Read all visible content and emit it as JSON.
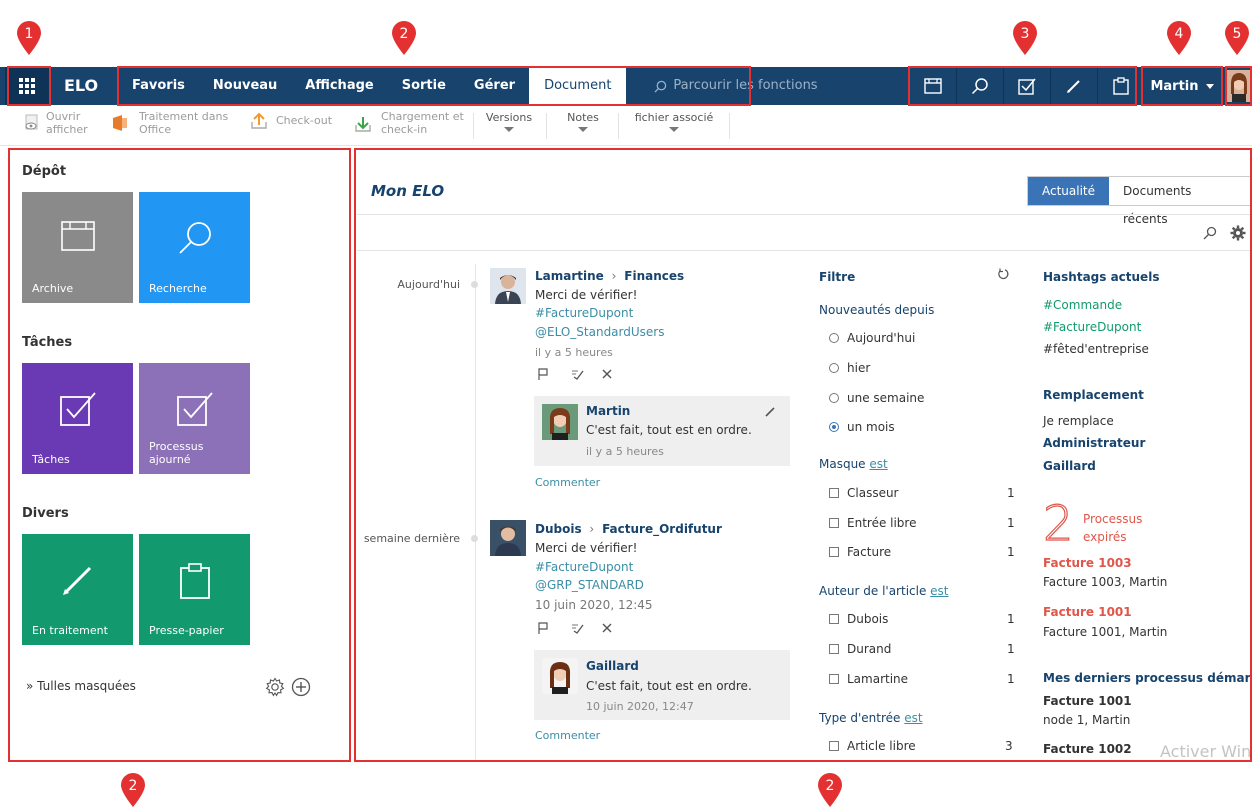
{
  "topbar": {
    "brand": "ELO",
    "menu": [
      "Favoris",
      "Nouveau",
      "Affichage",
      "Sortie",
      "Gérer",
      "Document"
    ],
    "search_placeholder": "Parcourir les fonctions",
    "user": "Martin"
  },
  "callouts": [
    "1",
    "2",
    "3",
    "4",
    "5",
    "2",
    "2"
  ],
  "ribbon": {
    "open": [
      "Ouvrir",
      "afficher"
    ],
    "office": [
      "Traitement dans",
      "Office"
    ],
    "checkout": "Check-out",
    "checkin": [
      "Chargement et",
      "check-in"
    ],
    "versions": "Versions",
    "notes": "Notes",
    "associated": "fichier associé"
  },
  "left": {
    "depot": "Dépôt",
    "taches_title": "Tâches",
    "divers": "Divers",
    "tiles": {
      "archive": "Archive",
      "recherche": "Recherche",
      "taches": "Tâches",
      "processus": [
        "Processus",
        "ajourné"
      ],
      "traitement": "En traitement",
      "presse": "Presse-papier"
    },
    "hidden_tiles": "» Tulles masquées"
  },
  "main": {
    "title": "Mon ELO",
    "tabs": [
      "Actualité",
      "Documents récents"
    ],
    "feed": [
      {
        "date": "Aujourd'hui",
        "author": "Lamartine",
        "target": "Finances",
        "text": "Merci de vérifier!",
        "hashtag": "#FactureDupont",
        "mention": "@ELO_StandardUsers",
        "time": "il y a 5 heures",
        "reply": {
          "author": "Martin",
          "text": "C'est fait, tout est en ordre.",
          "time": "il y a 5 heures"
        },
        "comment": "Commenter"
      },
      {
        "date": "semaine dernière",
        "author": "Dubois",
        "target": "Facture_Ordifutur",
        "text": "Merci de vérifier!",
        "hashtag": "#FactureDupont",
        "mention": "@GRP_STANDARD",
        "time": "10 juin 2020, 12:45",
        "reply": {
          "author": "Gaillard",
          "text": "C'est fait, tout est en ordre.",
          "time": "10 juin 2020, 12:47"
        },
        "comment": "Commenter"
      }
    ],
    "filter": {
      "title": "Filtre",
      "since_label": "Nouveautés depuis",
      "since_options": [
        "Aujourd'hui",
        "hier",
        "une semaine",
        "un mois"
      ],
      "selected_since": "un mois",
      "mask_label": "Masque",
      "is": "est",
      "mask_items": [
        {
          "label": "Classeur",
          "count": "1"
        },
        {
          "label": "Entrée libre",
          "count": "1"
        },
        {
          "label": "Facture",
          "count": "1"
        }
      ],
      "author_label": "Auteur de l'article",
      "author_items": [
        {
          "label": "Dubois",
          "count": "1"
        },
        {
          "label": "Durand",
          "count": "1"
        },
        {
          "label": "Lamartine",
          "count": "1"
        }
      ],
      "type_label": "Type d'entrée",
      "type_items": [
        {
          "label": "Article libre",
          "count": "3"
        }
      ]
    },
    "right": {
      "hashtags_title": "Hashtags actuels",
      "hashtags": [
        "#Commande",
        "#FactureDupont",
        "#fêted'entreprise"
      ],
      "replacement_title": "Remplacement",
      "replace_text": "Je remplace",
      "replace_names": [
        "Administrateur",
        "Gaillard"
      ],
      "expired_count": "2",
      "expired_label": [
        "Processus",
        "expirés"
      ],
      "expired_items": [
        {
          "title": "Facture 1003",
          "sub": "Facture 1003, Martin"
        },
        {
          "title": "Facture 1001",
          "sub": "Facture 1001, Martin"
        }
      ],
      "started_title": "Mes derniers processus démarrés",
      "started_items": [
        {
          "title": "Facture 1001",
          "sub": "node 1, Martin"
        },
        {
          "title": "Facture 1002",
          "sub": ""
        }
      ]
    },
    "watermark": "Activer Wind"
  },
  "colors": {
    "topbar": "#17436d",
    "archive": "#8a8a8a",
    "recherche": "#2196f3",
    "taches": "#6a3ab5",
    "processus": "#8d71b8",
    "green": "#129a6e",
    "callout": "#e33030"
  }
}
